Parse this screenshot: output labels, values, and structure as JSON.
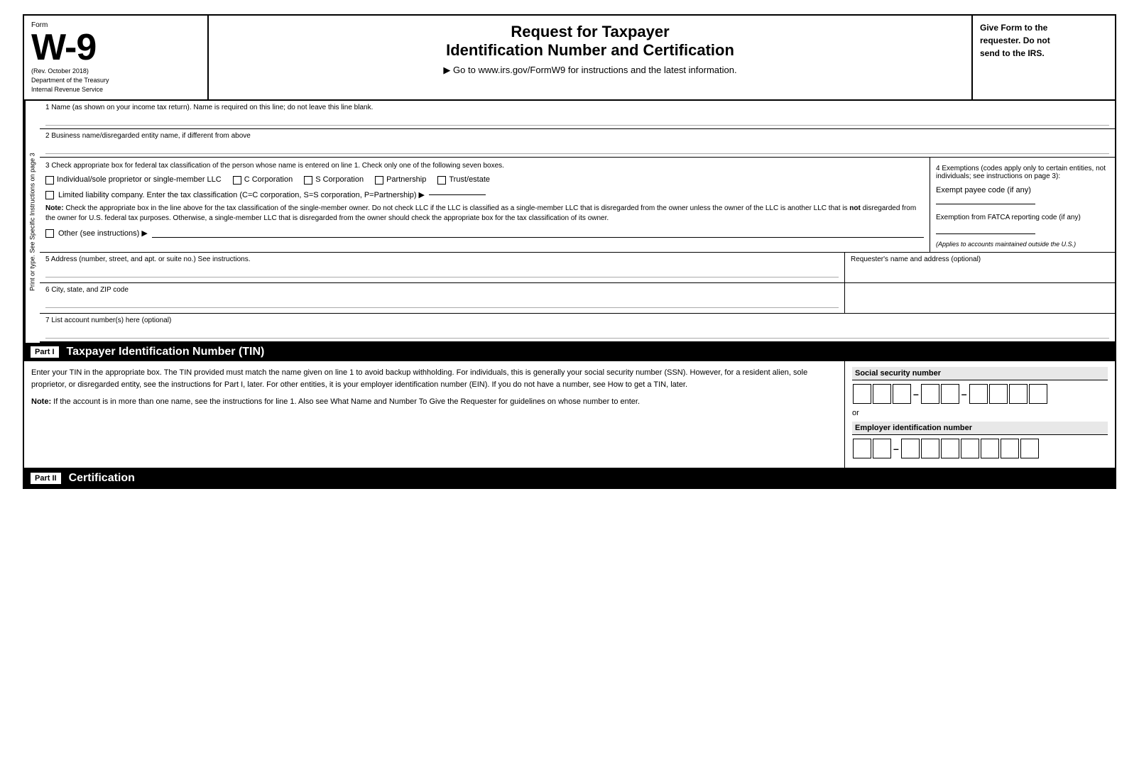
{
  "header": {
    "form_word": "Form",
    "form_number": "W-9",
    "rev_date": "(Rev. October 2018)",
    "dept_line1": "Department of the Treasury",
    "dept_line2": "Internal Revenue Service",
    "title_line1": "Request for Taxpayer",
    "title_line2": "Identification Number and Certification",
    "subtitle": "▶ Go to www.irs.gov/FormW9 for instructions and the latest information.",
    "right_text_line1": "Give Form to the",
    "right_text_line2": "requester. Do not",
    "right_text_line3": "send to the IRS."
  },
  "side_label": "Print or type. See Specific Instructions on page 3",
  "fields": {
    "field1_label": "1  Name (as shown on your income tax return). Name is required on this line; do not leave this line blank.",
    "field2_label": "2  Business name/disregarded entity name, if different from above",
    "field3_label": "3  Check appropriate box for federal tax classification of the person whose name is entered on line 1. Check only one of the following seven boxes.",
    "cb_individual": "Individual/sole proprietor or single-member LLC",
    "cb_c_corp": "C Corporation",
    "cb_s_corp": "S Corporation",
    "cb_partnership": "Partnership",
    "cb_trust": "Trust/estate",
    "llc_label": "Limited liability company. Enter the tax classification (C=C corporation, S=S corporation, P=Partnership) ▶",
    "note_title": "Note:",
    "note_text": " Check the appropriate box in the line above for the tax classification of the single-member owner. Do not check LLC if the LLC is classified as a single-member LLC that is disregarded from the owner unless the owner of the LLC is another LLC that is ",
    "note_not": "not",
    "note_text2": " disregarded from the owner for U.S. federal tax purposes. Otherwise, a single-member LLC that is disregarded from the owner should check the appropriate box for the tax classification of its owner.",
    "other_label": "Other (see instructions) ▶",
    "field4_label": "4  Exemptions (codes apply only to certain entities, not individuals; see instructions on page 3):",
    "exempt_payee_label": "Exempt payee code (if any)",
    "fatca_label": "Exemption from FATCA reporting code (if any)",
    "applies_note": "(Applies to accounts maintained outside the U.S.)",
    "field5_label": "5  Address (number, street, and apt. or suite no.) See instructions.",
    "requesters_label": "Requester's name and address (optional)",
    "field6_label": "6  City, state, and ZIP code",
    "field7_label": "7  List account number(s) here (optional)"
  },
  "part1": {
    "box_label": "Part I",
    "title": "Taxpayer Identification Number (TIN)",
    "description": "Enter your TIN in the appropriate box. The TIN provided must match the name given on line 1 to avoid backup withholding. For individuals, this is generally your social security number (SSN). However, for a resident alien, sole proprietor, or disregarded entity, see the instructions for Part I, later. For other entities, it is your employer identification number (EIN). If you do not have a number, see How to get a TIN, later.",
    "note_label": "Note:",
    "note_text": " If the account is in more than one name, see the instructions for line 1. Also see What Name and Number To Give the Requester for guidelines on whose number to enter.",
    "ssn_label": "Social security number",
    "or_text": "or",
    "ein_label": "Employer identification number"
  },
  "part2": {
    "box_label": "Part II",
    "title": "Certification"
  }
}
